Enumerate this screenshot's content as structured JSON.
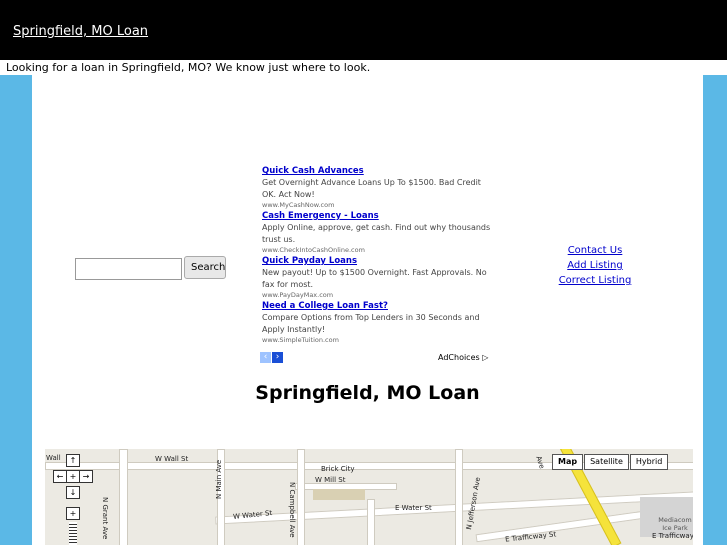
{
  "header": {
    "site_link": "Springfield, MO Loan"
  },
  "tagline": "Looking for a loan in Springfield, MO? We know just where to look.",
  "search": {
    "button_label": "Search",
    "value": ""
  },
  "ads": {
    "items": [
      {
        "title": "Quick Cash Advances",
        "text": "Get Overnight Advance Loans Up To $1500. Bad Credit OK. Act Now!",
        "url": "www.MyCashNow.com"
      },
      {
        "title": "Cash Emergency - Loans",
        "text": "Apply Online, approve, get cash. Find out why thousands trust us.",
        "url": "www.CheckIntoCashOnline.com"
      },
      {
        "title": "Quick Payday Loans",
        "text": "New payout! Up to $1500 Overnight. Fast Approvals. No fax for most.",
        "url": "www.PayDayMax.com"
      },
      {
        "title": "Need a College Loan Fast?",
        "text": "Compare Options from Top Lenders in 30 Seconds and Apply Instantly!",
        "url": "www.SimpleTuition.com"
      }
    ],
    "adchoices_label": "AdChoices ▷",
    "prev_icon": "‹",
    "next_icon": "›"
  },
  "links": {
    "contact": "Contact Us",
    "add": "Add Listing",
    "correct": "Correct Listing"
  },
  "page_title": "Springfield, MO Loan",
  "map": {
    "types": [
      "Map",
      "Satellite",
      "Hybrid"
    ],
    "active_type": "Map",
    "labels": {
      "wall_left": "Wall",
      "wall": "W Wall St",
      "mill": "W Mill St",
      "brick_city": "Brick City",
      "water_w": "W Water St",
      "water_e": "E Water St",
      "grant": "N Grant Ave",
      "main": "N Main Ave",
      "campbell": "N Campbell Ave",
      "jefferson": "N Jefferson Ave",
      "trafficway": "E Trafficway St",
      "trafficway_right": "E Trafficway",
      "mediacom": "Mediacom Ice Park",
      "ave_top": "Ave",
      "on_ave": "on Ave",
      "n_ave": "Ave"
    }
  }
}
